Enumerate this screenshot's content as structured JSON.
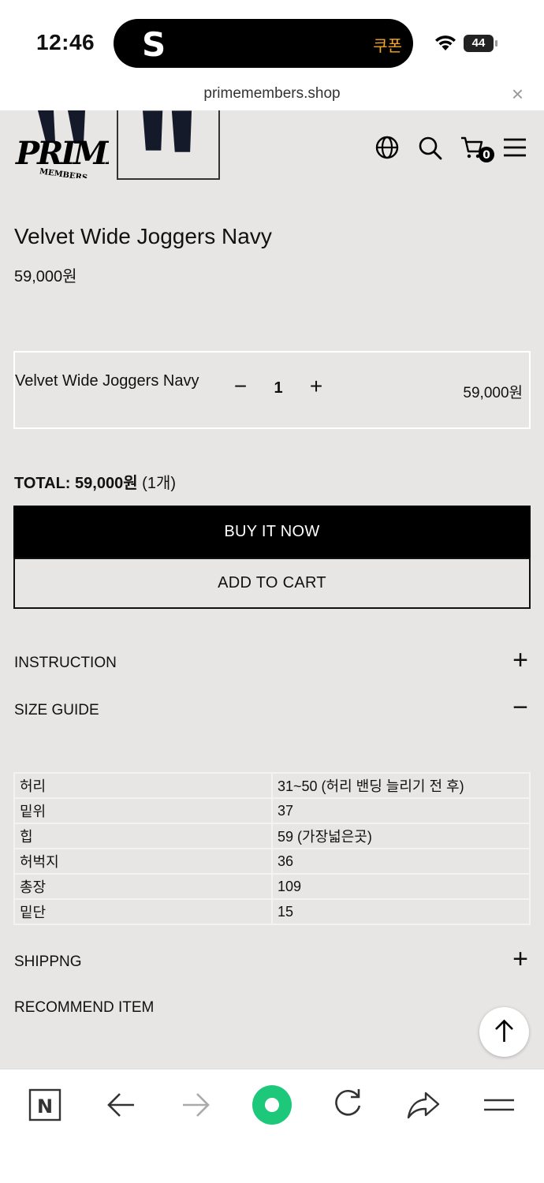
{
  "status_bar": {
    "time": "12:46",
    "app_letter": "S",
    "coupon_label": "쿠폰",
    "battery": "44"
  },
  "browser": {
    "url": "primemembers.shop",
    "close_glyph": "×"
  },
  "header": {
    "logo_alt": "PRIME MEMBERS",
    "icons": [
      "globe-icon",
      "search-icon",
      "cart-icon",
      "menu-icon"
    ],
    "cart_count": "0"
  },
  "product": {
    "title": "Velvet Wide Joggers Navy",
    "price": "59,000원"
  },
  "option": {
    "name": "Velvet Wide Joggers Navy",
    "minus": "−",
    "quantity": "1",
    "plus": "+",
    "price": "59,000원"
  },
  "total": {
    "label": "TOTAL: 59,000원",
    "count": "(1개)"
  },
  "buttons": {
    "buy_now": "BUY IT NOW",
    "add_to_cart": "ADD TO CART"
  },
  "accordion": {
    "instruction": {
      "label": "INSTRUCTION",
      "symbol": "+"
    },
    "size_guide": {
      "label": "SIZE GUIDE",
      "symbol": "−"
    },
    "shipping": {
      "label": "SHIPPNG",
      "symbol": "+"
    },
    "recommend": {
      "label": "RECOMMEND ITEM"
    }
  },
  "size_table": [
    {
      "key": "허리",
      "value": "31~50 (허리 밴딩 늘리기 전 후)"
    },
    {
      "key": "밑위",
      "value": "37"
    },
    {
      "key": "힙",
      "value": "59 (가장넓은곳)"
    },
    {
      "key": "허벅지",
      "value": "36"
    },
    {
      "key": "총장",
      "value": "109"
    },
    {
      "key": "밑단",
      "value": "15"
    }
  ],
  "toolbar": [
    "naver-n-icon",
    "back-arrow-icon",
    "forward-arrow-icon",
    "green-dot-home-icon",
    "reload-icon",
    "share-icon",
    "hamburger-menu-icon"
  ],
  "colors": {
    "background": "#e8e6e5",
    "buy_button": "#000000",
    "coupon": "#f5a623",
    "naver_green": "#1ec800"
  }
}
